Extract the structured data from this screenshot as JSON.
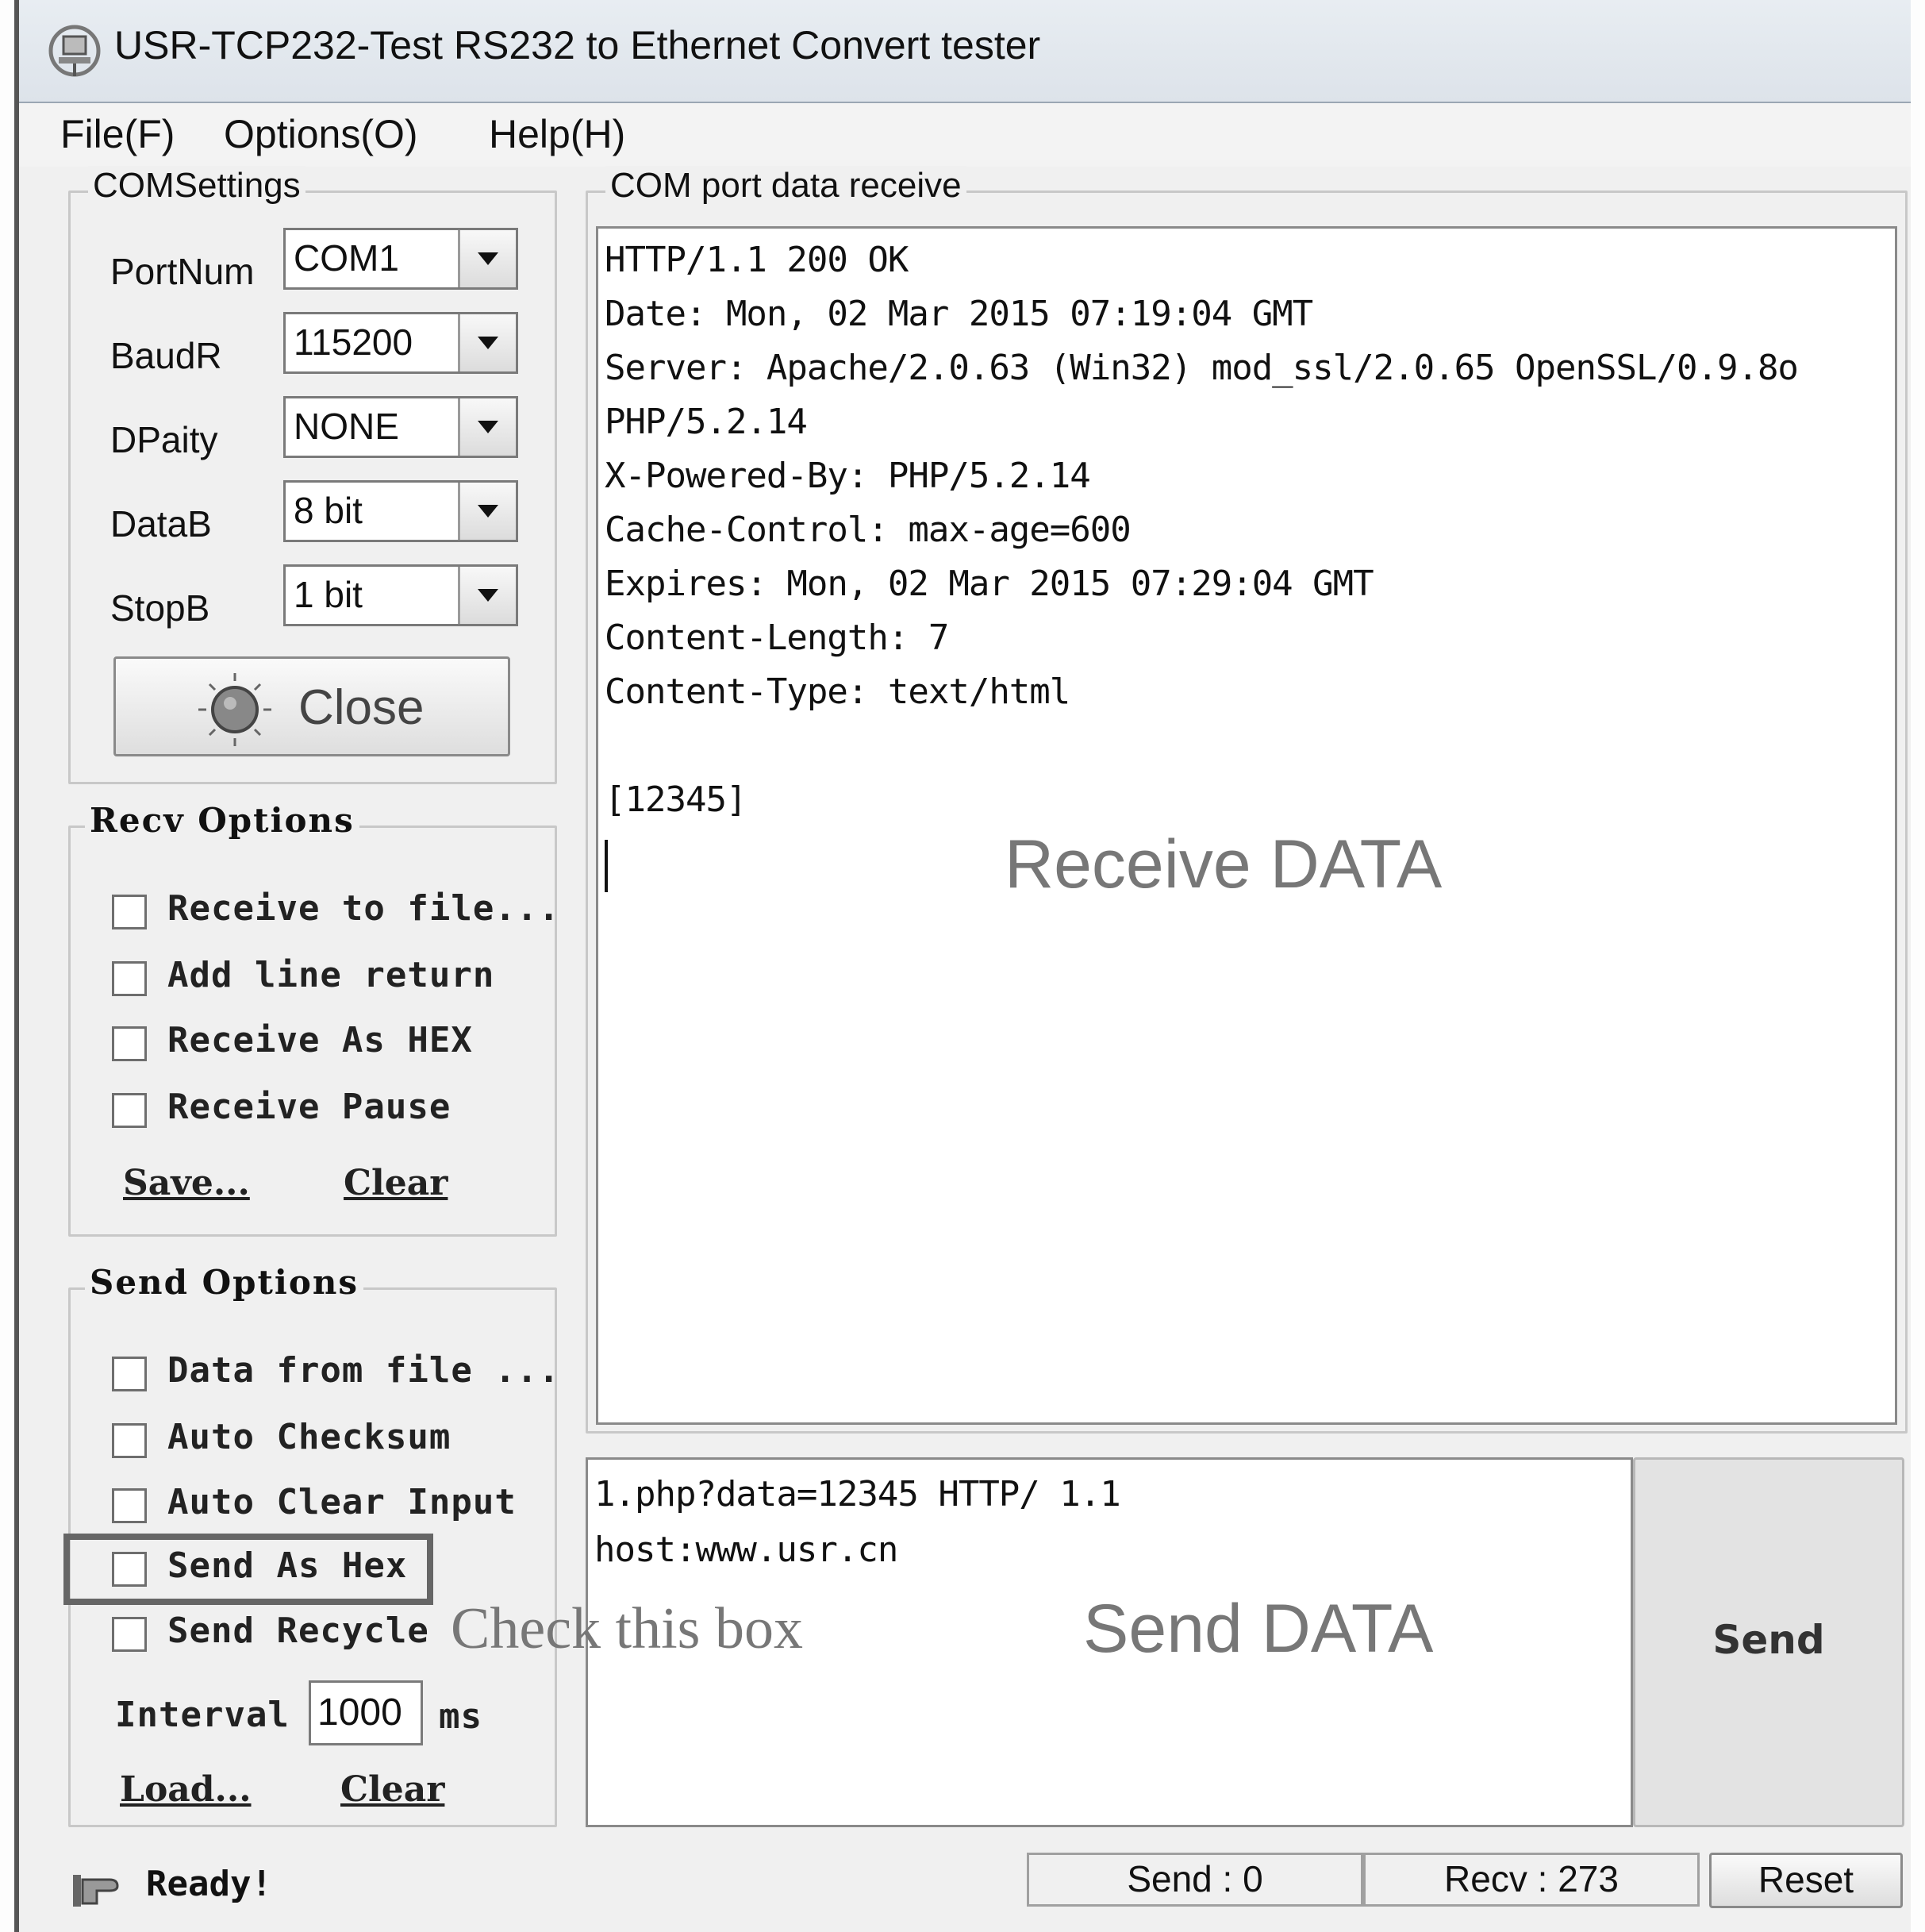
{
  "window": {
    "title": "USR-TCP232-Test  RS232 to Ethernet Convert tester",
    "app_icon": "network-computer-icon"
  },
  "menu": {
    "items": [
      "File(F)",
      "Options(O)",
      "Help(H)"
    ]
  },
  "com_settings": {
    "title": "COMSettings",
    "fields": [
      {
        "label": "PortNum",
        "value": "COM1"
      },
      {
        "label": "BaudR",
        "value": "115200"
      },
      {
        "label": "DPaity",
        "value": "NONE"
      },
      {
        "label": "DataB",
        "value": "8 bit"
      },
      {
        "label": "StopB",
        "value": "1 bit"
      }
    ],
    "close_button": "Close",
    "close_icon": "port-status-light-icon"
  },
  "recv_options": {
    "title": "Recv Options",
    "checkboxes": [
      {
        "label": "Receive to file...",
        "checked": false
      },
      {
        "label": "Add line return",
        "checked": false
      },
      {
        "label": "Receive As HEX",
        "checked": false
      },
      {
        "label": "Receive Pause",
        "checked": false
      }
    ],
    "save_link": "Save...",
    "clear_link": "Clear"
  },
  "send_options": {
    "title": "Send Options",
    "checkboxes": [
      {
        "label": "Data from file ...",
        "checked": false
      },
      {
        "label": "Auto Checksum",
        "checked": false
      },
      {
        "label": "Auto Clear Input",
        "checked": false
      },
      {
        "label": "Send As Hex",
        "checked": false
      },
      {
        "label": "Send Recycle",
        "checked": false
      }
    ],
    "interval_label": "Interval",
    "interval_value": "1000",
    "interval_unit": "ms",
    "load_link": "Load...",
    "clear_link": "Clear"
  },
  "receive_panel": {
    "title": "COM port data receive",
    "lines": [
      "HTTP/1.1 200 OK",
      "Date: Mon, 02 Mar 2015 07:19:04 GMT",
      "Server: Apache/2.0.63 (Win32) mod_ssl/2.0.65 OpenSSL/0.9.8o",
      "PHP/5.2.14",
      "X-Powered-By: PHP/5.2.14",
      "Cache-Control: max-age=600",
      "Expires: Mon, 02 Mar 2015 07:29:04 GMT",
      "Content-Length: 7",
      "Content-Type: text/html",
      "",
      "[12345]"
    ],
    "overlay": "Receive DATA"
  },
  "send_panel": {
    "lines": [
      "1.php?data=12345 HTTP/ 1.1",
      "host:www.usr.cn"
    ],
    "overlay": "Send DATA",
    "send_button": "Send"
  },
  "annotation": {
    "check_hint": "Check this box"
  },
  "status_bar": {
    "status_icon": "hand-pointer-icon",
    "status_text": "Ready!",
    "send_count": "Send : 0",
    "recv_count": "Recv : 273",
    "reset_button": "Reset"
  }
}
